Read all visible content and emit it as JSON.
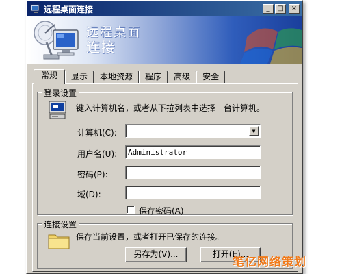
{
  "window": {
    "title": "远程桌面连接",
    "minimize": "_",
    "maximize": "□",
    "close": "×"
  },
  "banner": {
    "line1": "远程桌面",
    "line2": "连接"
  },
  "tabs": [
    {
      "label": "常规",
      "active": true
    },
    {
      "label": "显示",
      "active": false
    },
    {
      "label": "本地资源",
      "active": false
    },
    {
      "label": "程序",
      "active": false
    },
    {
      "label": "高级",
      "active": false
    },
    {
      "label": "安全",
      "active": false
    }
  ],
  "logon": {
    "legend": "登录设置",
    "description": "键入计算机名，或者从下拉列表中选择一台计算机。",
    "computer_label": "计算机(C):",
    "computer_value": "",
    "username_label": "用户名(U):",
    "username_value": "Administrator",
    "password_label": "密码(P):",
    "password_value": "",
    "domain_label": "域(D):",
    "domain_value": "",
    "save_password_label": "保存密码(A)",
    "save_password_checked": false
  },
  "connection": {
    "legend": "连接设置",
    "description": "保存当前设置，或者打开已保存的连接。",
    "save_as_button": "另存为(V)...",
    "open_button": "打开(E)..."
  },
  "watermark": {
    "text": "笔亿网络策划"
  },
  "colors": {
    "titlebar_start": "#0a246a",
    "titlebar_end": "#3a6ea5",
    "dialog_face": "#d4d0c8",
    "watermark": "#f07a1a"
  }
}
